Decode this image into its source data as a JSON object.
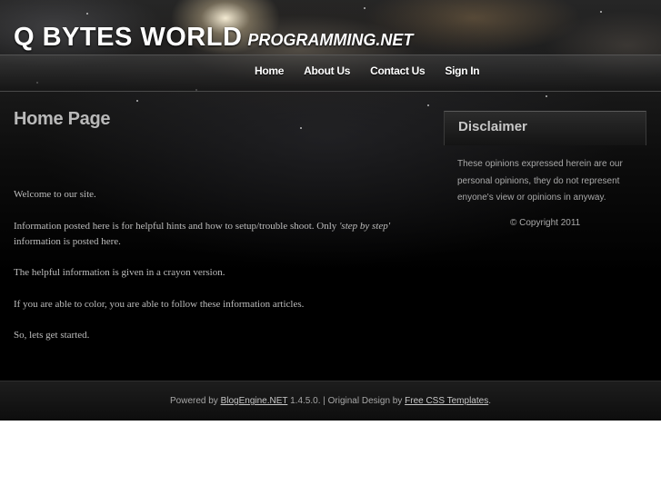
{
  "header": {
    "logo_main": "Q BYTES WORLD",
    "logo_sub": "PROGRAMMING.NET"
  },
  "nav": {
    "items": [
      {
        "label": "Home"
      },
      {
        "label": "About Us"
      },
      {
        "label": "Contact Us"
      },
      {
        "label": "Sign In"
      }
    ]
  },
  "main": {
    "title": "Home Page",
    "paragraphs": {
      "p1": "Welcome to our site.",
      "p2_before": "Information posted here is for helpful hints and how to setup/trouble shoot.  Only ",
      "p2_emphasis": "'step by step'",
      "p2_after": " information is posted here.",
      "p3": "The helpful information is given in a crayon version.",
      "p4": "If you are able to color, you are able to follow these information articles.",
      "p5": "So, lets get started."
    }
  },
  "sidebar": {
    "disclaimer_title": "Disclaimer",
    "disclaimer_text": "These opinions expressed herein are our personal opinions, they do not represent enyone's view or opinions in anyway.",
    "copyright": "© Copyright 2011"
  },
  "footer": {
    "powered_by": "Powered by ",
    "engine_link": "BlogEngine.NET",
    "version_text": " 1.4.5.0. | Original Design by ",
    "design_link": "Free CSS Templates",
    "end": "."
  },
  "colors": {
    "background": "#000000",
    "text": "#bdbdbd",
    "heading": "#b9b9b9",
    "nav_text": "#ffffff"
  }
}
